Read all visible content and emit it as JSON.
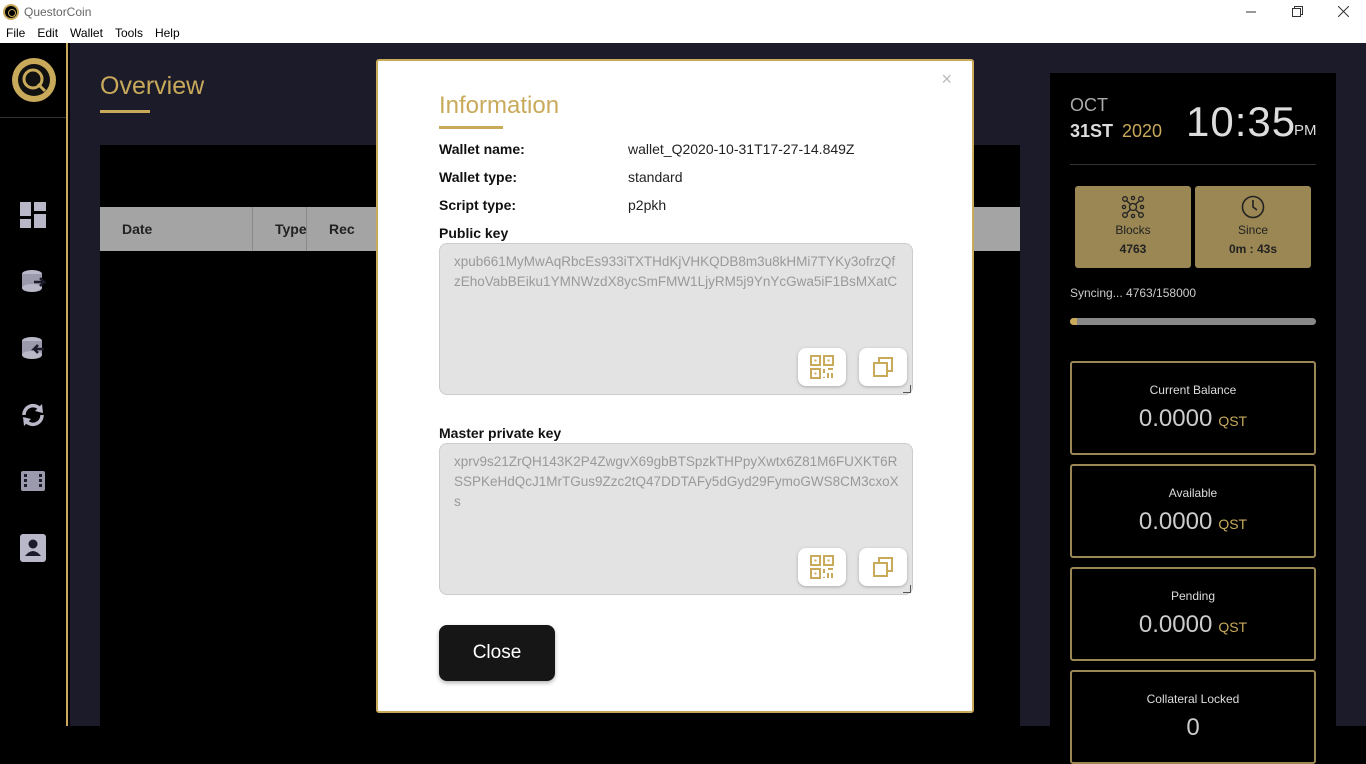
{
  "window": {
    "title": "QuestorCoin"
  },
  "menubar": [
    "File",
    "Edit",
    "Wallet",
    "Tools",
    "Help"
  ],
  "overview": {
    "title": "Overview",
    "table_headers": [
      "Date",
      "Type",
      "Rec"
    ]
  },
  "right_panel": {
    "month": "OCT",
    "day": "31ST",
    "year": "2020",
    "time": "10:35",
    "ampm": "PM",
    "blocks": {
      "label": "Blocks",
      "value": "4763"
    },
    "since": {
      "label": "Since",
      "value": "0m : 43s"
    },
    "sync_text": "Syncing...  4763/158000",
    "sync_progress_fraction": 0.0301,
    "balances": [
      {
        "label": "Current Balance",
        "amount": "0.0000",
        "unit": "QST"
      },
      {
        "label": "Available",
        "amount": "0.0000",
        "unit": "QST"
      },
      {
        "label": "Pending",
        "amount": "0.0000",
        "unit": "QST"
      },
      {
        "label": "Collateral Locked",
        "amount": "0",
        "unit": ""
      }
    ]
  },
  "modal": {
    "close_x": "×",
    "title": "Information",
    "wallet_name_label": "Wallet name:",
    "wallet_name_value": "wallet_Q2020-10-31T17-27-14.849Z",
    "wallet_type_label": "Wallet type:",
    "wallet_type_value": "standard",
    "script_type_label": "Script type:",
    "script_type_value": "p2pkh",
    "public_key_label": "Public key",
    "public_key_value": "xpub661MyMwAqRbcEs933iTXTHdKjVHKQDB8m3u8kHMi7TYKy3ofrzQfzEhoVabBEiku1YMNWzdX8ycSmFMW1LjyRM5j9YnYcGwa5iF1BsMXatC",
    "master_private_key_label": "Master private key",
    "master_private_key_value": "xprv9s21ZrQH143K2P4ZwgvX69gbBTSpzkTHPpyXwtx6Z81M6FUXKT6RSSPKeHdQcJ1MrTGus9Zzc2tQ47DDTAFy5dGyd29FymoGWS8CM3cxoXs",
    "close_button": "Close"
  },
  "colors": {
    "accent": "#c8aa5a",
    "card": "#9a8753"
  }
}
